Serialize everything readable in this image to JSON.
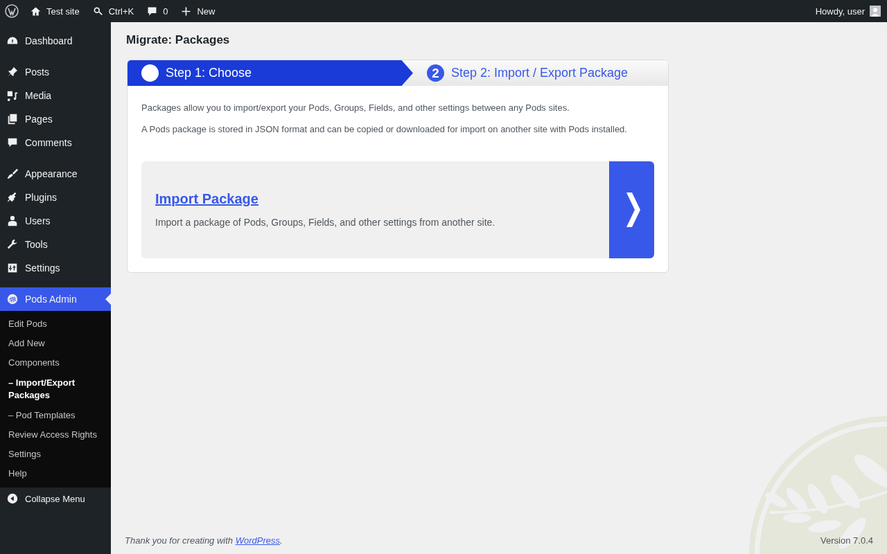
{
  "admin_bar": {
    "items": [
      {
        "label": "Test site"
      },
      {
        "label": "Ctrl+K"
      },
      {
        "label": "0"
      },
      {
        "label": "New"
      }
    ],
    "greeting": "Howdy, user"
  },
  "sidebar": {
    "groups": [
      [
        {
          "label": "Dashboard",
          "selected": false
        }
      ],
      [
        {
          "label": "Posts",
          "selected": false
        },
        {
          "label": "Media",
          "selected": false
        },
        {
          "label": "Pages",
          "selected": false
        },
        {
          "label": "Comments",
          "selected": false
        }
      ],
      [
        {
          "label": "Appearance",
          "selected": false
        },
        {
          "label": "Plugins",
          "selected": false
        },
        {
          "label": "Users",
          "selected": false
        },
        {
          "label": "Tools",
          "selected": false
        },
        {
          "label": "Settings",
          "selected": false
        }
      ],
      [
        {
          "label": "Pods Admin",
          "selected": true,
          "children": [
            {
              "label": "Edit Pods",
              "selected": false
            },
            {
              "label": "Add New",
              "selected": false
            },
            {
              "label": "Components",
              "selected": false
            },
            {
              "label": "– Import/Export Packages",
              "selected": true
            },
            {
              "label": "– Pod Templates",
              "selected": false
            },
            {
              "label": "Review Access Rights",
              "selected": false
            },
            {
              "label": "Settings",
              "selected": false
            },
            {
              "label": "Help",
              "selected": false
            }
          ]
        }
      ]
    ],
    "collapse": "Collapse Menu"
  },
  "page": {
    "title": "Migrate: Packages",
    "steps": [
      {
        "label": "Step 1: Choose",
        "selected": true
      },
      {
        "number": "2",
        "label": "Step 2: Import / Export Package",
        "selected": false
      }
    ],
    "paragraphs": [
      "Packages allow you to import/export your Pods, Groups, Fields, and other settings between any Pods sites.",
      "A Pods package is stored in JSON format and can be copied or downloaded for import on another site with Pods installed."
    ],
    "options": [
      {
        "title": "Import Package",
        "description": "Import a package of Pods, Groups, Fields, and other settings from another site."
      }
    ]
  },
  "footer": {
    "before": "Thank you for creating with ",
    "link": "WordPress",
    "after": ".",
    "version": "Version 7.0.4"
  }
}
